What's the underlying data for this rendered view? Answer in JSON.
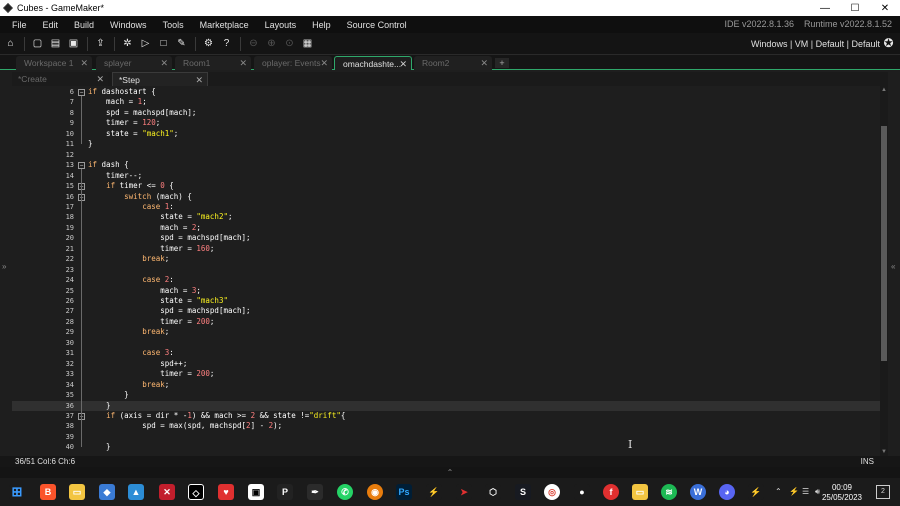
{
  "window": {
    "title": "Cubes - GameMaker*",
    "minimize": "—",
    "maximize": "☐",
    "close": "✕"
  },
  "menu": [
    "File",
    "Edit",
    "Build",
    "Windows",
    "Tools",
    "Marketplace",
    "Layouts",
    "Help",
    "Source Control"
  ],
  "versions": {
    "ide": "IDE v2022.8.1.36",
    "runtime": "Runtime v2022.8.1.52"
  },
  "targets": {
    "text": "Windows | VM | Default | Default"
  },
  "workspace_tabs": [
    {
      "label": "Workspace 1"
    },
    {
      "label": "splayer"
    },
    {
      "label": "Room1"
    },
    {
      "label": "oplayer: Events"
    },
    {
      "label": "omachdashte..."
    },
    {
      "label": "Room2"
    }
  ],
  "file_tabs": [
    {
      "label": "*Create"
    },
    {
      "label": "*Step"
    }
  ],
  "code_lines": [
    {
      "n": "6",
      "html": "<span class=\"kw\">if</span> dashostart {"
    },
    {
      "n": "7",
      "html": "    mach = <span class=\"num\">1</span>;"
    },
    {
      "n": "8",
      "html": "    spd = machspd[mach];"
    },
    {
      "n": "9",
      "html": "    timer = <span class=\"num\">120</span>;"
    },
    {
      "n": "10",
      "html": "    state = <span class=\"str\">\"mach1\"</span>;"
    },
    {
      "n": "11",
      "html": "}"
    },
    {
      "n": "12",
      "html": ""
    },
    {
      "n": "13",
      "html": "<span class=\"kw\">if</span> dash {"
    },
    {
      "n": "14",
      "html": "    timer--;"
    },
    {
      "n": "15",
      "html": "    <span class=\"kw\">if</span> timer &lt;= <span class=\"num\">0</span> {"
    },
    {
      "n": "16",
      "html": "        <span class=\"kw\">switch</span> (mach) {"
    },
    {
      "n": "17",
      "html": "            <span class=\"kw\">case</span> <span class=\"num\">1</span>:"
    },
    {
      "n": "18",
      "html": "                state = <span class=\"str\">\"mach2\"</span>;"
    },
    {
      "n": "19",
      "html": "                mach = <span class=\"num\">2</span>;"
    },
    {
      "n": "20",
      "html": "                spd = machspd[mach];"
    },
    {
      "n": "21",
      "html": "                timer = <span class=\"num\">160</span>;"
    },
    {
      "n": "22",
      "html": "            <span class=\"kw\">break</span>;"
    },
    {
      "n": "23",
      "html": ""
    },
    {
      "n": "24",
      "html": "            <span class=\"kw\">case</span> <span class=\"num\">2</span>:"
    },
    {
      "n": "25",
      "html": "                mach = <span class=\"num\">3</span>;"
    },
    {
      "n": "26",
      "html": "                state = <span class=\"str\">\"mach3\"</span>"
    },
    {
      "n": "27",
      "html": "                spd = machspd[mach];"
    },
    {
      "n": "28",
      "html": "                timer = <span class=\"num\">200</span>;"
    },
    {
      "n": "29",
      "html": "            <span class=\"kw\">break</span>;"
    },
    {
      "n": "30",
      "html": ""
    },
    {
      "n": "31",
      "html": "            <span class=\"kw\">case</span> <span class=\"num\">3</span>:"
    },
    {
      "n": "32",
      "html": "                spd++;"
    },
    {
      "n": "33",
      "html": "                timer = <span class=\"num\">200</span>;"
    },
    {
      "n": "34",
      "html": "            <span class=\"kw\">break</span>;"
    },
    {
      "n": "35",
      "html": "        }"
    },
    {
      "n": "36",
      "html": "    }"
    },
    {
      "n": "37",
      "html": "    <span class=\"kw\">if</span> (axis = dir * -<span class=\"num\">1</span>) &amp;&amp; mach &gt;= <span class=\"num\">2</span> &amp;&amp; state !=<span class=\"str\">\"drift\"</span>{"
    },
    {
      "n": "38",
      "html": "            spd = max(spd, machspd[<span class=\"num\">2</span>] - <span class=\"num\">2</span>);"
    },
    {
      "n": "39",
      "html": ""
    },
    {
      "n": "40",
      "html": "    }"
    }
  ],
  "status": {
    "position": "36/51 Col:6 Ch:6",
    "mode": "INS"
  },
  "clock": {
    "time": "00:09",
    "date": "25/05/2023"
  },
  "notifications": "2"
}
